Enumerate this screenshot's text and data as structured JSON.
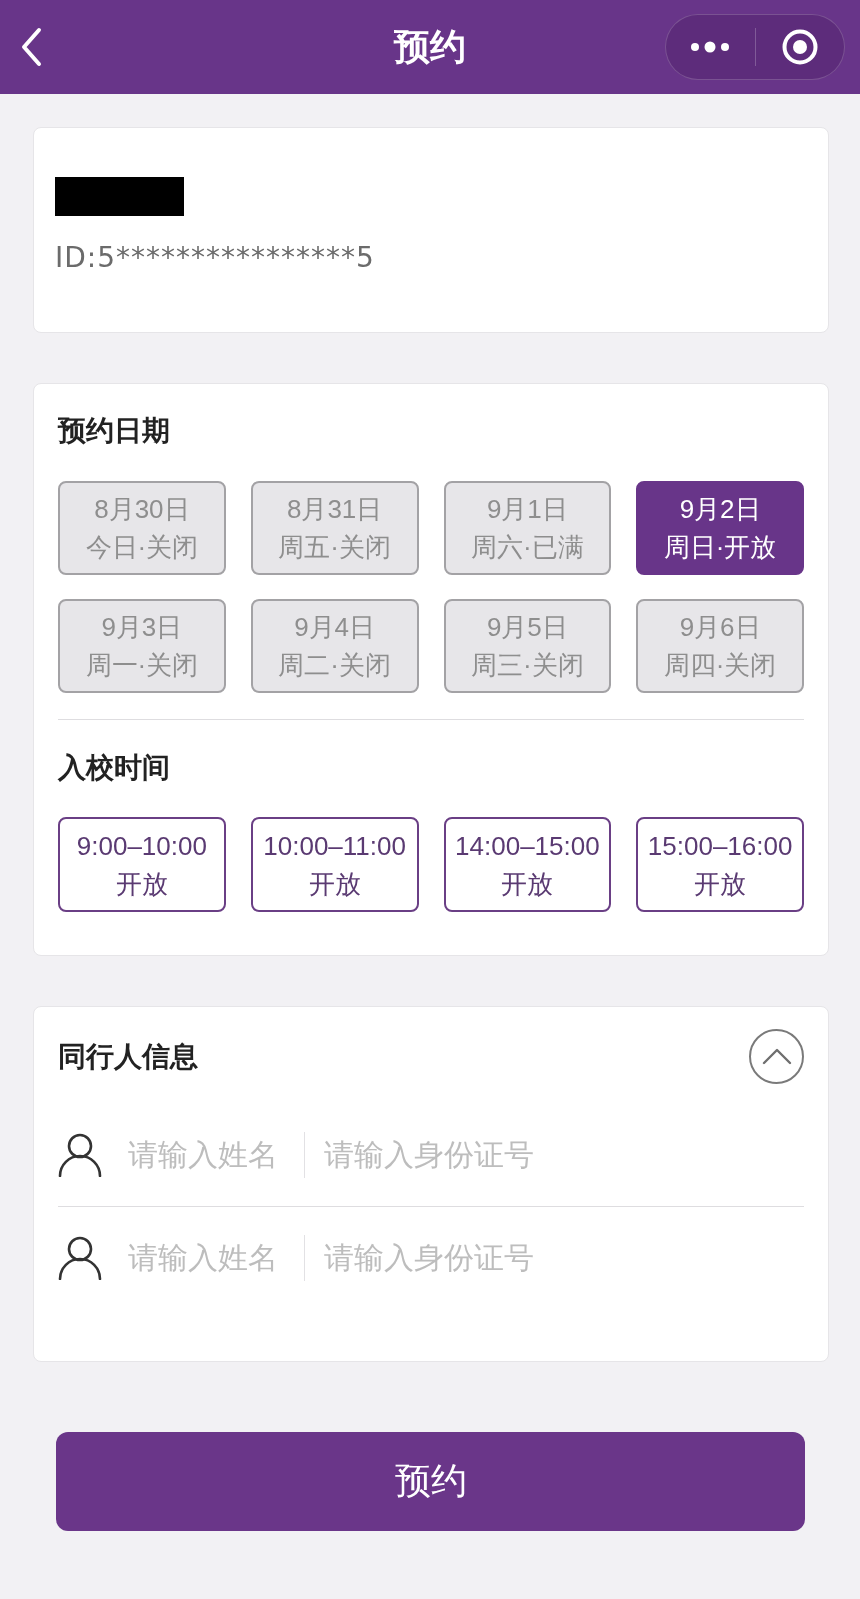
{
  "header": {
    "title": "预约"
  },
  "profile": {
    "name_redacted": true,
    "id_text": "ID:5****************5"
  },
  "schedule": {
    "date_title": "预约日期",
    "dates": [
      {
        "date": "8月30日",
        "status": "今日·关闭",
        "selected": false,
        "disabled": true
      },
      {
        "date": "8月31日",
        "status": "周五·关闭",
        "selected": false,
        "disabled": true
      },
      {
        "date": "9月1日",
        "status": "周六·已满",
        "selected": false,
        "disabled": true
      },
      {
        "date": "9月2日",
        "status": "周日·开放",
        "selected": true,
        "disabled": false
      },
      {
        "date": "9月3日",
        "status": "周一·关闭",
        "selected": false,
        "disabled": true
      },
      {
        "date": "9月4日",
        "status": "周二·关闭",
        "selected": false,
        "disabled": true
      },
      {
        "date": "9月5日",
        "status": "周三·关闭",
        "selected": false,
        "disabled": true
      },
      {
        "date": "9月6日",
        "status": "周四·关闭",
        "selected": false,
        "disabled": true
      }
    ],
    "time_title": "入校时间",
    "slots": [
      {
        "time": "9:00–10:00",
        "status": "开放",
        "selected": false,
        "disabled": false
      },
      {
        "time": "10:00–11:00",
        "status": "开放",
        "selected": false,
        "disabled": false
      },
      {
        "time": "14:00–15:00",
        "status": "开放",
        "selected": false,
        "disabled": false
      },
      {
        "time": "15:00–16:00",
        "status": "开放",
        "selected": false,
        "disabled": false
      }
    ]
  },
  "companions": {
    "title": "同行人信息",
    "expanded": true,
    "rows": [
      {
        "name_field": {
          "placeholder": "请输入姓名"
        },
        "id_field": {
          "placeholder": "请输入身份证号"
        }
      },
      {
        "name_field": {
          "placeholder": "请输入姓名"
        },
        "id_field": {
          "placeholder": "请输入身份证号"
        }
      }
    ]
  },
  "submit_button": {
    "label": "预约"
  }
}
